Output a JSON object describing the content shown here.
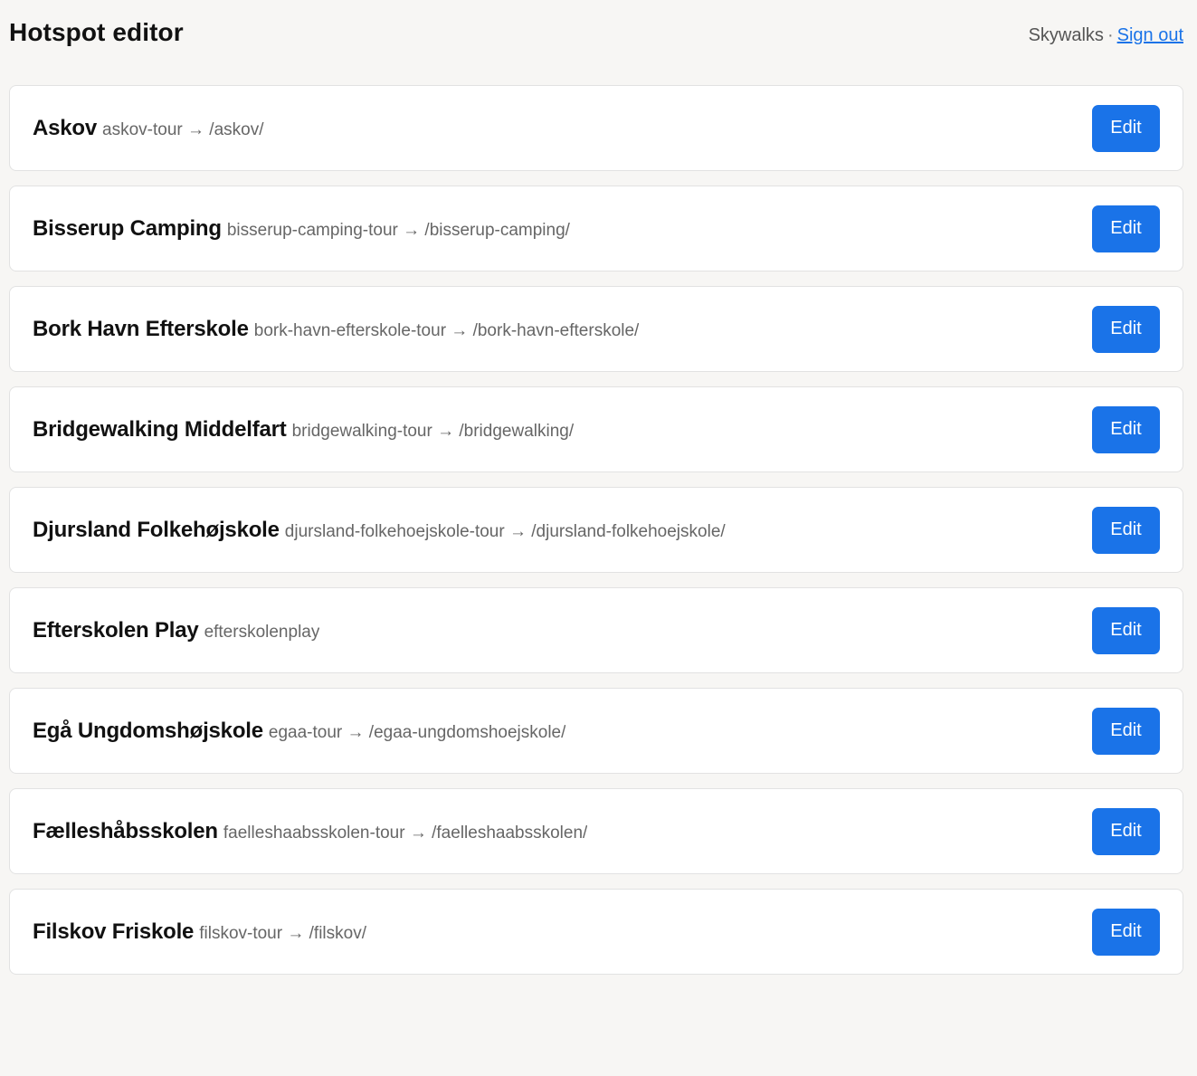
{
  "header": {
    "title": "Hotspot editor",
    "account_name": "Skywalks",
    "separator": "·",
    "signout_label": "Sign out"
  },
  "hotspots": [
    {
      "name": "Askov",
      "slug": "askov-tour → /askov/",
      "edit_label": "Edit"
    },
    {
      "name": "Bisserup Camping",
      "slug": "bisserup-camping-tour → /bisserup-camping/",
      "edit_label": "Edit"
    },
    {
      "name": "Bork Havn Efterskole",
      "slug": "bork-havn-efterskole-tour → /bork-havn-efterskole/",
      "edit_label": "Edit"
    },
    {
      "name": "Bridgewalking Middelfart",
      "slug": "bridgewalking-tour → /bridgewalking/",
      "edit_label": "Edit"
    },
    {
      "name": "Djursland Folkehøjskole",
      "slug": "djursland-folkehoejskole-tour → /djursland-folkehoejskole/",
      "edit_label": "Edit"
    },
    {
      "name": "Efterskolen Play",
      "slug": "efterskolenplay",
      "edit_label": "Edit"
    },
    {
      "name": "Egå Ungdomshøjskole",
      "slug": "egaa-tour → /egaa-ungdomshoejskole/",
      "edit_label": "Edit"
    },
    {
      "name": "Fælleshåbsskolen",
      "slug": "faelleshaabsskolen-tour → /faelleshaabsskolen/",
      "edit_label": "Edit"
    },
    {
      "name": "Filskov Friskole",
      "slug": "filskov-tour → /filskov/",
      "edit_label": "Edit"
    }
  ]
}
